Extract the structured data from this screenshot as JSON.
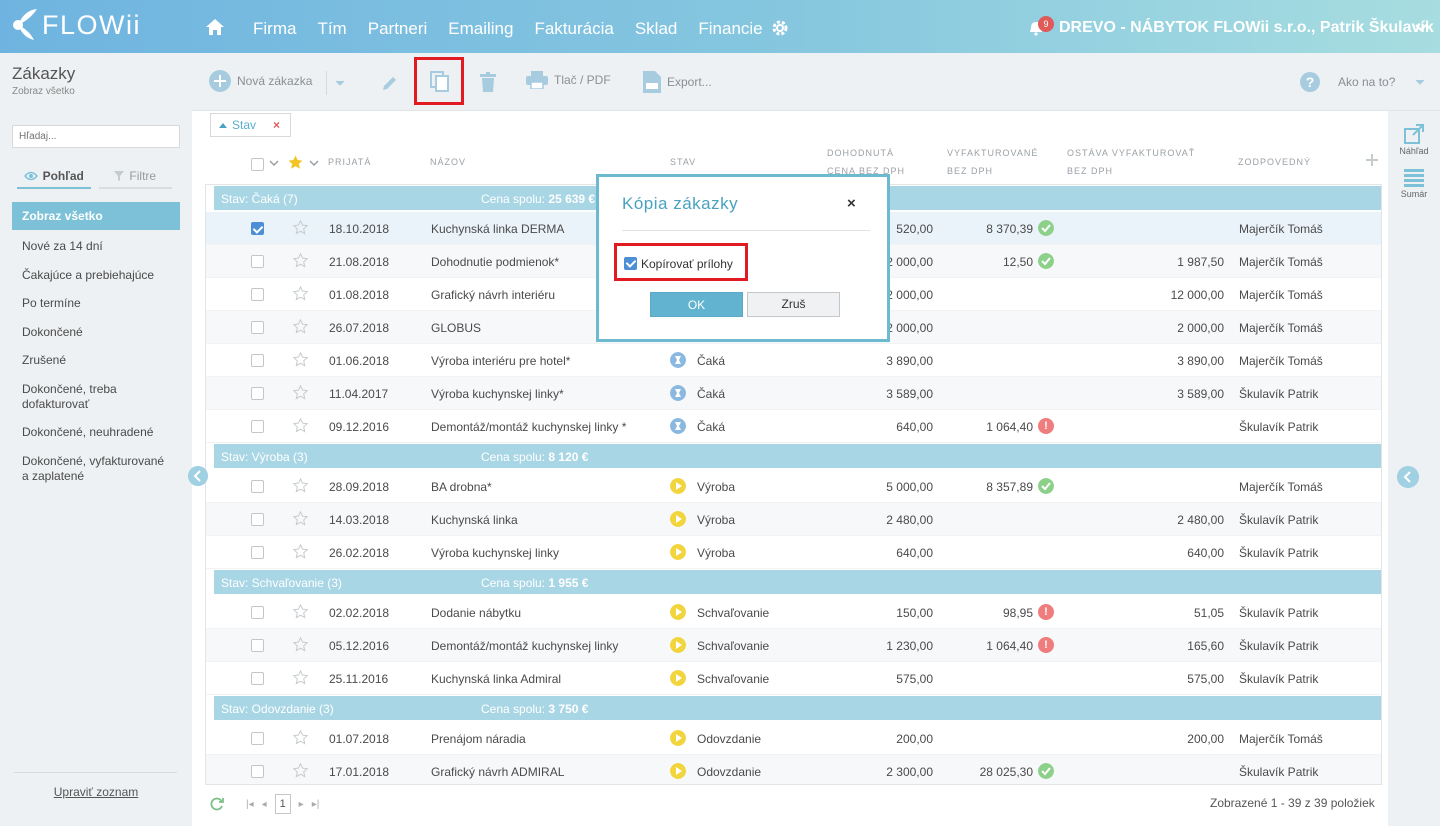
{
  "app": {
    "logo": "FLOWii",
    "company": "DREVO - NÁBYTOK FLOWii s.r.o., Patrik Škulavík",
    "notifications": "9"
  },
  "nav": [
    "Firma",
    "Tím",
    "Partneri",
    "Emailing",
    "Fakturácia",
    "Sklad",
    "Financie"
  ],
  "left": {
    "title": "Zákazky",
    "subtitle": "Zobraz všetko",
    "search_placeholder": "Hľadaj...",
    "tab_view": "Pohľad",
    "tab_filters": "Filtre",
    "items": [
      "Zobraz všetko",
      "Nové za 14 dní",
      "Čakajúce a prebiehajúce",
      "Po termíne",
      "Dokončené",
      "Zrušené",
      "Dokončené, treba dofakturovať",
      "Dokončené, neuhradené",
      "Dokončené, vyfakturované a zaplatené"
    ],
    "edit_list": "Upraviť zoznam"
  },
  "toolbar": {
    "new": "Nová zákazka",
    "print": "Tlač / PDF",
    "export": "Export...",
    "help": "Ako na to?"
  },
  "filter_chip": "Stav",
  "columns": {
    "received": "Prijatá",
    "name": "Názov",
    "status": "Stav",
    "agreed1": "Dohodnutá",
    "agreed2": "cena bez DPH",
    "invoiced1": "Vyfakturované",
    "invoiced2": "bez DPH",
    "remaining1": "Ostáva vyfakturovať",
    "remaining2": "bez DPH",
    "responsible": "Zodpovedný"
  },
  "groups": [
    {
      "label": "Stav: Čaká (7)",
      "sum_label": "Cena spolu:",
      "sum": "25 639 €"
    },
    {
      "label": "Stav: Výroba (3)",
      "sum_label": "Cena spolu:",
      "sum": "8 120 €"
    },
    {
      "label": "Stav: Schvaľovanie (3)",
      "sum_label": "Cena spolu:",
      "sum": "1 955 €"
    },
    {
      "label": "Stav: Odovzdanie (3)",
      "sum_label": "Cena spolu:",
      "sum": "3 750 €"
    }
  ],
  "rows": [
    {
      "date": "18.10.2018",
      "name": "Kuchynská linka DERMA",
      "status": "",
      "price": "520,00",
      "inv": "8 370,39",
      "inv_icon": "ok",
      "rem": "",
      "resp": "Majerčík Tomáš",
      "checked": true
    },
    {
      "date": "21.08.2018",
      "name": "Dohodnutie podmienok*",
      "status": "",
      "price": "2 000,00",
      "inv": "12,50",
      "inv_icon": "ok",
      "rem": "1 987,50",
      "resp": "Majerčík Tomáš"
    },
    {
      "date": "01.08.2018",
      "name": "Grafický návrh interiéru",
      "status": "",
      "price": "2 000,00",
      "inv": "",
      "inv_icon": "",
      "rem": "12 000,00",
      "resp": "Majerčík Tomáš"
    },
    {
      "date": "26.07.2018",
      "name": "GLOBUS",
      "status": "",
      "price": "2 000,00",
      "inv": "",
      "inv_icon": "",
      "rem": "2 000,00",
      "resp": "Majerčík Tomáš"
    },
    {
      "date": "01.06.2018",
      "name": "Výroba interiéru pre hotel*",
      "status": "Čaká",
      "price": "3 890,00",
      "inv": "",
      "inv_icon": "",
      "rem": "3 890,00",
      "resp": "Majerčík Tomáš"
    },
    {
      "date": "11.04.2017",
      "name": "Výroba kuchynskej linky*",
      "status": "Čaká",
      "price": "3 589,00",
      "inv": "",
      "inv_icon": "",
      "rem": "3 589,00",
      "resp": "Škulavík Patrik"
    },
    {
      "date": "09.12.2016",
      "name": "Demontáž/montáž kuchynskej linky *",
      "status": "Čaká",
      "price": "640,00",
      "inv": "1 064,40",
      "inv_icon": "warn",
      "rem": "",
      "resp": "Škulavík Patrik"
    },
    {
      "date": "28.09.2018",
      "name": "BA drobna*",
      "status": "Výroba",
      "price": "5 000,00",
      "inv": "8 357,89",
      "inv_icon": "ok",
      "rem": "",
      "resp": "Majerčík Tomáš"
    },
    {
      "date": "14.03.2018",
      "name": "Kuchynská linka",
      "status": "Výroba",
      "price": "2 480,00",
      "inv": "",
      "inv_icon": "",
      "rem": "2 480,00",
      "resp": "Škulavík Patrik"
    },
    {
      "date": "26.02.2018",
      "name": "Výroba kuchynskej linky",
      "status": "Výroba",
      "price": "640,00",
      "inv": "",
      "inv_icon": "",
      "rem": "640,00",
      "resp": "Škulavík Patrik"
    },
    {
      "date": "02.02.2018",
      "name": "Dodanie nábytku",
      "status": "Schvaľovanie",
      "price": "150,00",
      "inv": "98,95",
      "inv_icon": "warn",
      "rem": "51,05",
      "resp": "Škulavík Patrik"
    },
    {
      "date": "05.12.2016",
      "name": "Demontáž/montáž kuchynskej linky",
      "status": "Schvaľovanie",
      "price": "1 230,00",
      "inv": "1 064,40",
      "inv_icon": "warn",
      "rem": "165,60",
      "resp": "Škulavík Patrik"
    },
    {
      "date": "25.11.2016",
      "name": "Kuchynská linka Admiral",
      "status": "Schvaľovanie",
      "price": "575,00",
      "inv": "",
      "inv_icon": "",
      "rem": "575,00",
      "resp": "Škulavík Patrik"
    },
    {
      "date": "01.07.2018",
      "name": "Prenájom náradia",
      "status": "Odovzdanie",
      "price": "200,00",
      "inv": "",
      "inv_icon": "",
      "rem": "200,00",
      "resp": "Majerčík Tomáš"
    },
    {
      "date": "17.01.2018",
      "name": "Grafický návrh ADMIRAL",
      "status": "Odovzdanie",
      "price": "2 300,00",
      "inv": "28 025,30",
      "inv_icon": "ok",
      "rem": "",
      "resp": "Škulavík Patrik"
    }
  ],
  "footer": {
    "page": "1",
    "count": "Zobrazené 1 - 39 z 39 položiek"
  },
  "rail": {
    "preview": "Náhľad",
    "summary": "Sumár"
  },
  "modal": {
    "title": "Kópia zákazky",
    "close": "×",
    "checkbox_label": "Kopírovať prílohy",
    "checked": true,
    "ok": "OK",
    "cancel": "Zruš"
  },
  "colors": {
    "accent": "#7cc1d8",
    "highlight": "#e21b22",
    "ok": "#8cd08a",
    "warn": "#ef7d7d",
    "wait": "#8ab8e0",
    "prod": "#f2d43c"
  }
}
